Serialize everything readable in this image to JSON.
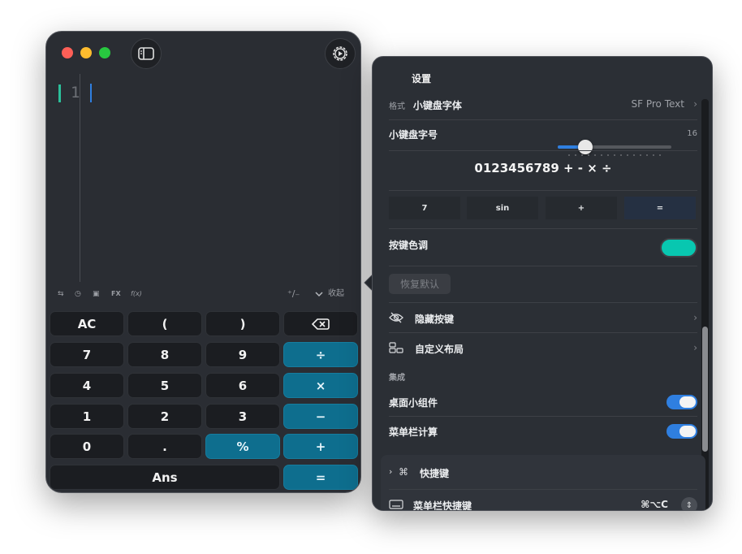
{
  "calculator": {
    "input_line_number": "1",
    "toolbar": {
      "swap_label": "⇆",
      "history_label": "◷",
      "memory_label": "▣",
      "fx_label": "FX",
      "fn_label": "f(x)",
      "sign_label": "⁺∕₋",
      "collapse_label": "收起"
    },
    "keys": {
      "ac": "AC",
      "open_paren": "(",
      "close_paren": ")",
      "seven": "7",
      "eight": "8",
      "nine": "9",
      "divide": "÷",
      "four": "4",
      "five": "5",
      "six": "6",
      "multiply": "×",
      "one": "1",
      "two": "2",
      "three": "3",
      "minus": "−",
      "zero": "0",
      "decimal": ".",
      "percent": "%",
      "plus": "+",
      "ans": "Ans",
      "equals": "="
    }
  },
  "settings": {
    "title": "设置",
    "format_label": "格式",
    "keypad_font_label": "小键盘字体",
    "keypad_font_value": "SF Pro Text",
    "keypad_size_label": "小键盘字号",
    "keypad_size_value": "16",
    "keypad_size_fraction": 0.24,
    "preview_digits": "0123456789 + - × ÷",
    "preview_keys": [
      "7",
      "sin",
      "+",
      "="
    ],
    "key_tint_label": "按键色调",
    "key_tint_color": "#08c7b0",
    "reset_label": "恢复默认",
    "hide_keys_label": "隐藏按键",
    "custom_layout_label": "自定义布局",
    "integration_header": "集成",
    "desktop_widget_label": "桌面小组件",
    "desktop_widget_on": true,
    "menubar_calc_label": "菜单栏计算",
    "menubar_calc_on": true,
    "shortcuts_label": "快捷键",
    "menubar_shortcut_label": "菜单栏快捷键",
    "menubar_shortcut_keys": "⌘⌥C"
  }
}
